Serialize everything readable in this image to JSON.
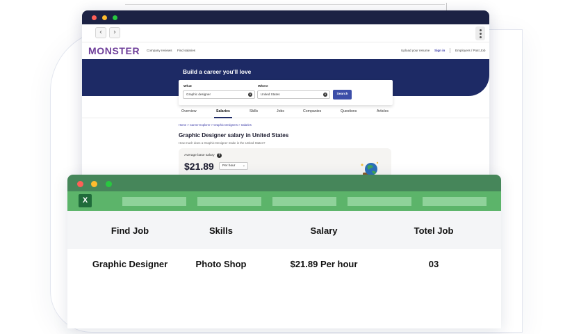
{
  "browser": {
    "nav": {
      "back_icon": "chevron-left-icon",
      "forward_icon": "chevron-right-icon",
      "menu_icon": "kebab-icon"
    },
    "header": {
      "logo": "MONSTER",
      "links_left": [
        "Company reviews",
        "Find salaries"
      ],
      "upload_resume": "Upload your resume",
      "sign_in": "Sign in",
      "employers": "Employers / Post Job"
    },
    "hero": {
      "title": "Build a career you'll love"
    },
    "search": {
      "what_label": "What",
      "what_value": "Graphic designer",
      "where_label": "Where",
      "where_value": "United States",
      "button": "Search"
    },
    "tabs": [
      "Overview",
      "Salaries",
      "Skills",
      "Jobs",
      "Companies",
      "Questions",
      "Articles"
    ],
    "active_tab": "Salaries",
    "breadcrumb": "Home > Career Explorer > Graphic Designers > Salaries",
    "title": "Graphic Designer salary in United States",
    "subtitle": "How much does a Graphic Designer make in the United States?",
    "salary_card": {
      "label": "Average base salary",
      "value": "$21.89",
      "period": "Per hour"
    }
  },
  "spreadsheet": {
    "logo": "X",
    "headers": [
      "Find Job",
      "Skills",
      "Salary",
      "Totel Job"
    ],
    "row": [
      "Graphic Designer",
      "Photo Shop",
      "$21.89 Per hour",
      "03"
    ]
  },
  "colors": {
    "monster_purple": "#6e3e9a",
    "hero_navy": "#1d2a65",
    "search_button": "#3c4ea8",
    "excel_titlebar": "#46865a",
    "excel_ribbon": "#5cb46a"
  }
}
